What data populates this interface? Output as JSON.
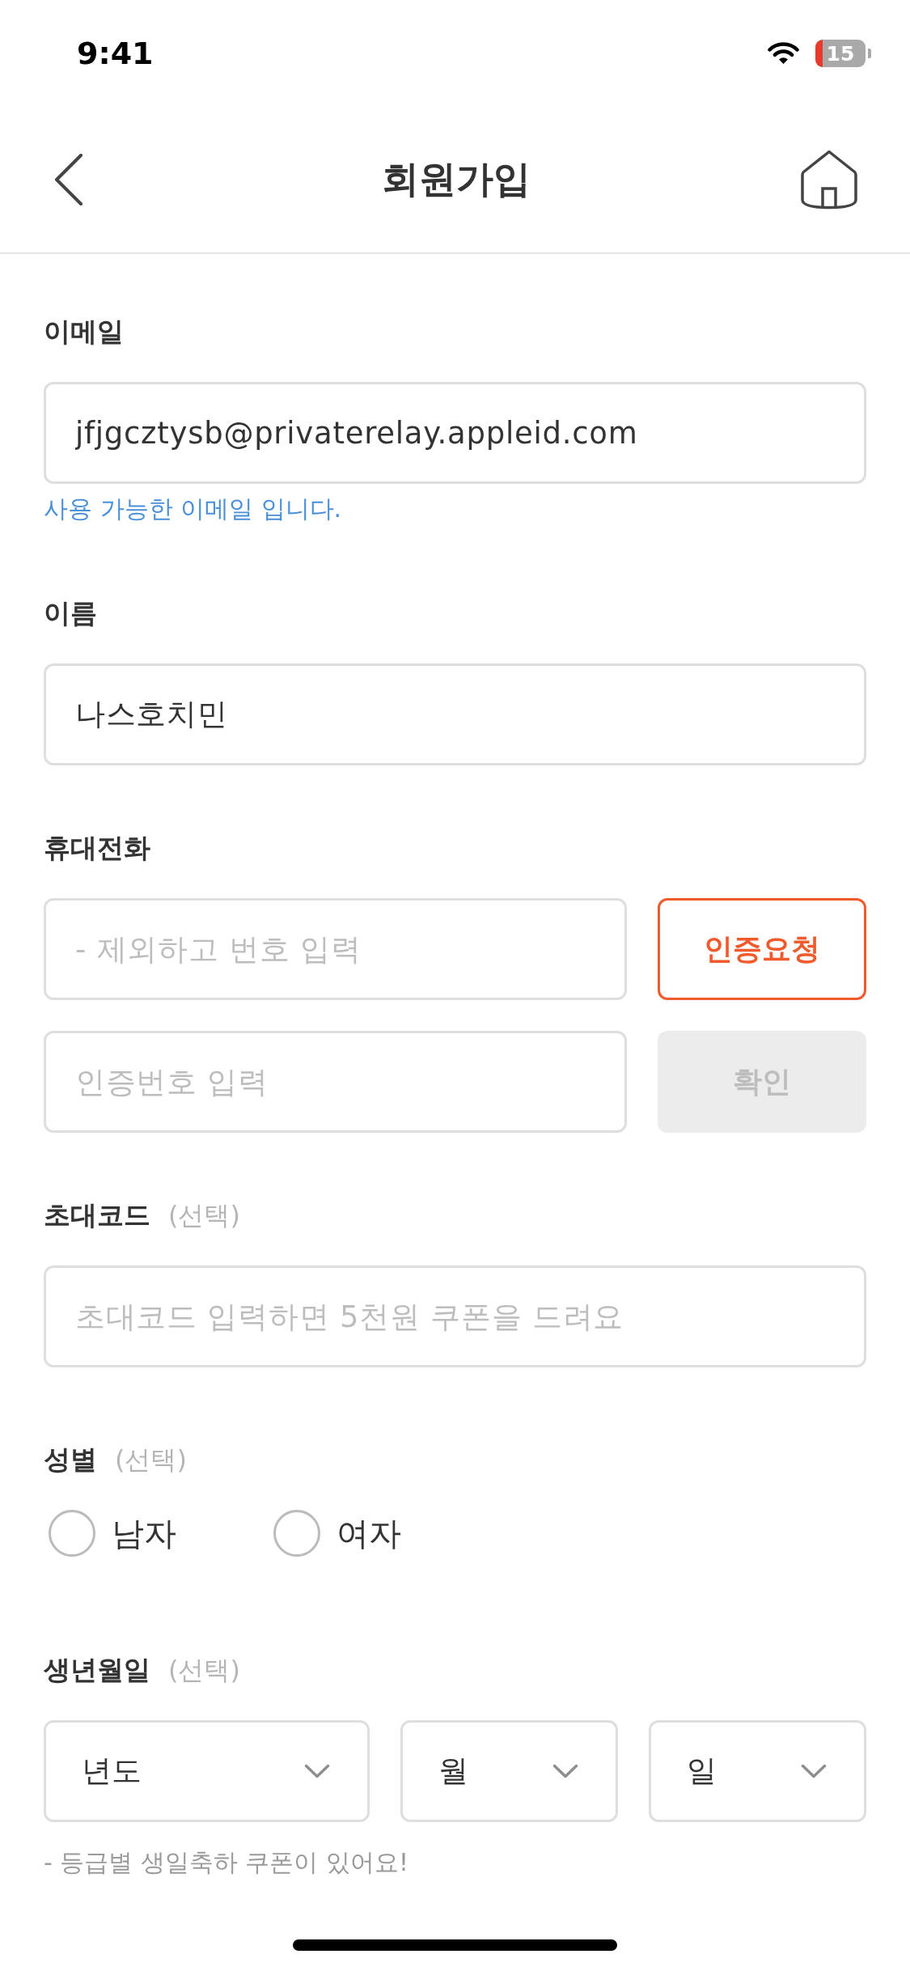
{
  "status_bar": {
    "time": "9:41",
    "battery": "15"
  },
  "header": {
    "title": "회원가입"
  },
  "form": {
    "sections": [
      {
        "kind": "text",
        "label": "이메일",
        "value": "jfjgcztysb@privaterelay.appleid.com",
        "helper": "사용 가능한 이메일 입니다."
      },
      {
        "kind": "text",
        "label": "이름",
        "value": "나스호치민"
      },
      {
        "kind": "verify",
        "label": "휴대전화",
        "rows": [
          {
            "placeholder": "- 제외하고 번호 입력",
            "button": {
              "label": "인증요청",
              "disabled": false
            }
          },
          {
            "placeholder": "인증번호 입력",
            "button": {
              "label": "확인",
              "disabled": true
            }
          }
        ]
      },
      {
        "kind": "text",
        "label": "초대코드",
        "optional": "(선택)",
        "placeholder": "초대코드 입력하면 5천원 쿠폰을 드려요"
      },
      {
        "kind": "radio",
        "label": "성별",
        "optional": "(선택)",
        "options": [
          {
            "label": "남자",
            "selected": false
          },
          {
            "label": "여자",
            "selected": false
          }
        ]
      },
      {
        "kind": "date",
        "label": "생년월일",
        "optional": "(선택)",
        "selects": [
          {
            "label": "년도"
          },
          {
            "label": "월"
          },
          {
            "label": "일"
          }
        ],
        "note": "- 등급별 생일축하 쿠폰이 있어요!"
      }
    ]
  }
}
